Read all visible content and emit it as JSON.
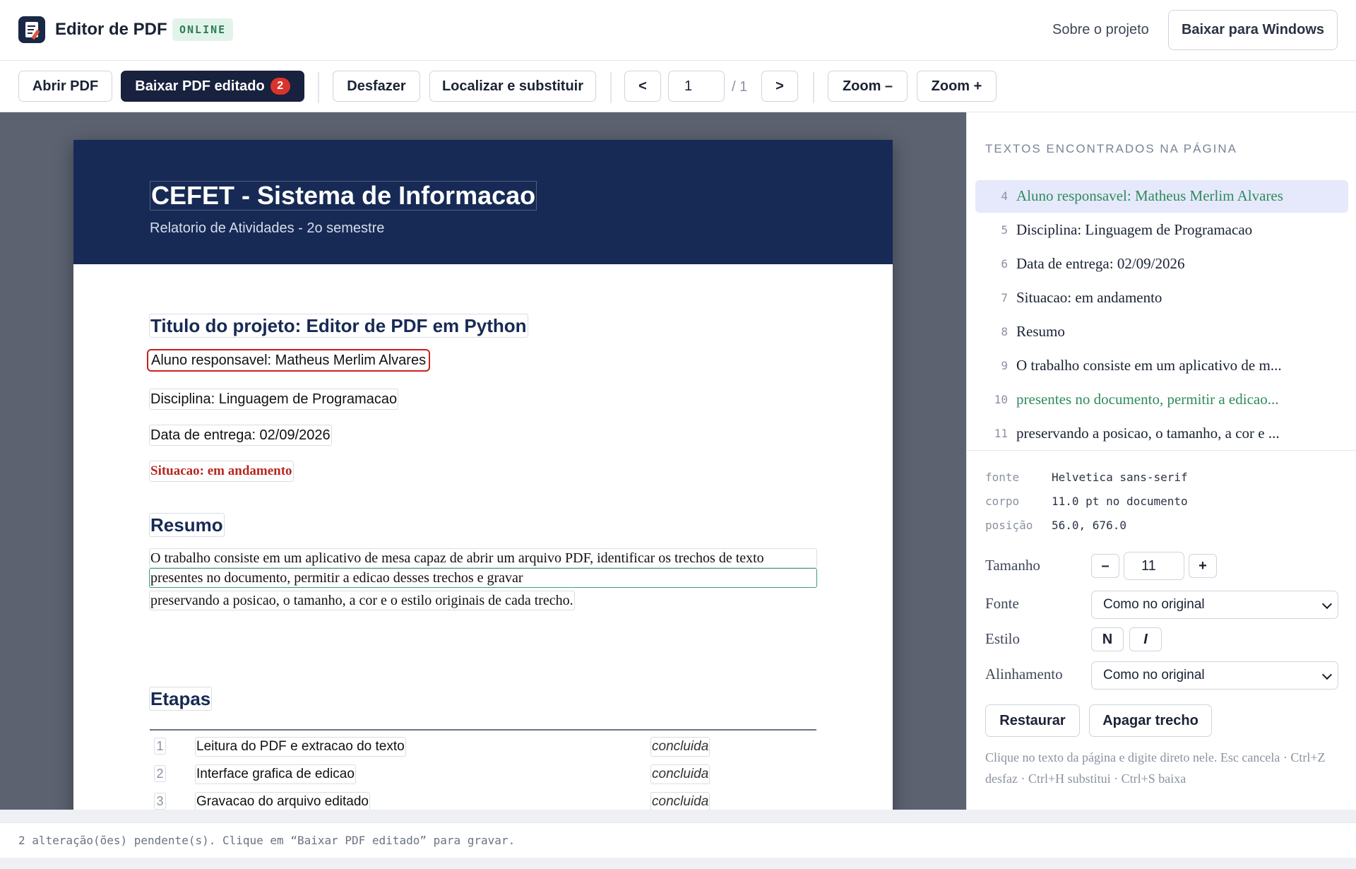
{
  "header": {
    "title": "Editor de PDF",
    "badge": "ONLINE",
    "about_link": "Sobre o projeto",
    "download_windows": "Baixar para Windows"
  },
  "toolbar": {
    "open": "Abrir PDF",
    "download_edited": "Baixar PDF editado",
    "pending_count": "2",
    "undo": "Desfazer",
    "find_replace": "Localizar e substituir",
    "prev": "<",
    "next": ">",
    "page_current": "1",
    "page_total": "/ 1",
    "zoom_out": "Zoom –",
    "zoom_in": "Zoom +"
  },
  "document": {
    "title": "CEFET - Sistema de Informacao",
    "subtitle": "Relatorio de Atividades - 2o semestre",
    "project_title": "Titulo do projeto: Editor de PDF em Python",
    "student": "Aluno responsavel: Matheus Merlim Alvares",
    "discipline": "Disciplina: Linguagem de Programacao",
    "due_date": "Data de entrega: 02/09/2026",
    "status": "Situacao: em andamento",
    "summary_heading": "Resumo",
    "summary_lines": [
      "O trabalho consiste em um aplicativo de mesa capaz de abrir um arquivo PDF, identificar os trechos de texto",
      "presentes no documento, permitir a edicao desses trechos e gravar",
      "preservando a posicao, o tamanho, a cor e o estilo originais de cada trecho."
    ],
    "steps_heading": "Etapas",
    "steps": [
      {
        "num": "1",
        "text": "Leitura do PDF e extracao do texto",
        "state": "concluida"
      },
      {
        "num": "2",
        "text": "Interface grafica de edicao",
        "state": "concluida"
      },
      {
        "num": "3",
        "text": "Gravacao do arquivo editado",
        "state": "concluida"
      }
    ]
  },
  "panel": {
    "title": "TEXTOS ENCONTRADOS NA PÁGINA",
    "items": [
      {
        "num": "4",
        "text": "Aluno responsavel: Matheus Merlim Alvares"
      },
      {
        "num": "5",
        "text": "Disciplina: Linguagem de Programacao"
      },
      {
        "num": "6",
        "text": "Data de entrega: 02/09/2026"
      },
      {
        "num": "7",
        "text": "Situacao: em andamento"
      },
      {
        "num": "8",
        "text": "Resumo"
      },
      {
        "num": "9",
        "text": "O trabalho consiste em um aplicativo de m..."
      },
      {
        "num": "10",
        "text": "presentes no documento, permitir a edicao..."
      },
      {
        "num": "11",
        "text": "preservando a posicao, o tamanho, a cor e ..."
      }
    ],
    "meta": {
      "font_label": "fonte",
      "font_value": "Helvetica sans-serif",
      "size_label": "corpo",
      "size_value": "11.0 pt no documento",
      "pos_label": "posição",
      "pos_value": "56.0, 676.0"
    },
    "size_label": "Tamanho",
    "size_minus": "–",
    "size_value": "11",
    "size_plus": "+",
    "font_label": "Fonte",
    "font_select": "Como no original",
    "style_label": "Estilo",
    "bold": "N",
    "italic": "I",
    "align_label": "Alinhamento",
    "align_select": "Como no original",
    "restore": "Restaurar",
    "delete": "Apagar trecho",
    "hint": "Clique no texto da página e digite direto nele. Esc cancela · Ctrl+Z desfaz · Ctrl+H substitui · Ctrl+S baixa"
  },
  "status": {
    "text": "2 alteração(ões) pendente(s). Clique em “Baixar PDF editado” para gravar."
  },
  "colors": {
    "header_band": "#172a55",
    "primary_button": "#18213d",
    "badge_red": "#d9342b",
    "selection_red": "#c8211c",
    "edited_green": "#3aa070",
    "active_item": "#e5e9fb"
  }
}
